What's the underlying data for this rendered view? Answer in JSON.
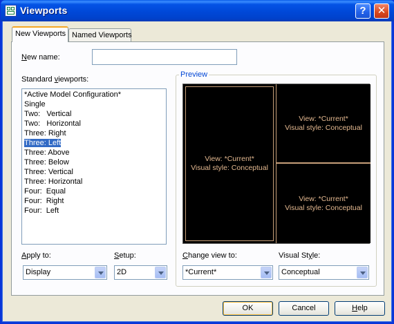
{
  "window": {
    "title": "Viewports"
  },
  "tabs": [
    {
      "label": "New Viewports"
    },
    {
      "label": "Named Viewports"
    }
  ],
  "new_name": {
    "label_accel": "N",
    "label_rest": "ew name:",
    "value": ""
  },
  "standard_viewports": {
    "label_pre": "Standard ",
    "label_accel": "v",
    "label_post": "iewports:",
    "items": [
      "*Active Model Configuration*",
      "Single",
      "Two:   Vertical",
      "Two:   Horizontal",
      "Three: Right",
      "Three: Left",
      "Three: Above",
      "Three: Below",
      "Three: Vertical",
      "Three: Horizontal",
      "Four:  Equal",
      "Four:  Right",
      "Four:  Left"
    ],
    "selected": "Three: Left"
  },
  "preview": {
    "label": "Preview",
    "viewports": [
      {
        "view": "View: *Current*",
        "style": "Visual style: Conceptual"
      },
      {
        "view": "View: *Current*",
        "style": "Visual style: Conceptual"
      },
      {
        "view": "View: *Current*",
        "style": "Visual style: Conceptual"
      }
    ]
  },
  "apply_to": {
    "label_accel": "A",
    "label_rest": "pply to:",
    "value": "Display"
  },
  "setup": {
    "label_accel": "S",
    "label_rest": "etup:",
    "value": "2D"
  },
  "change_view_to": {
    "label_accel": "C",
    "label_rest": "hange view to:",
    "value": "*Current*"
  },
  "visual_style": {
    "label_pre": "Visual St",
    "label_accel": "y",
    "label_post": "le:",
    "value": "Conceptual"
  },
  "buttons": {
    "ok": "OK",
    "cancel": "Cancel",
    "help_accel": "H",
    "help_rest": "elp"
  },
  "colors": {
    "selection": "#316ac5",
    "preview_text": "#e3b890",
    "group_title": "#0046d5"
  }
}
